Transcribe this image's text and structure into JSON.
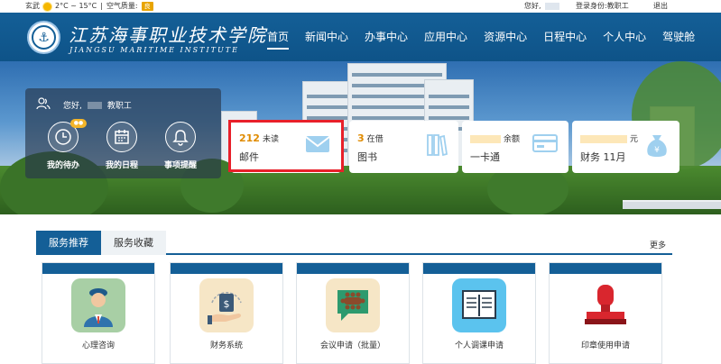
{
  "topbar": {
    "city": "玄武",
    "temperature": "2°C ~ 15°C",
    "separator": "|",
    "air_quality_label": "空气质量:",
    "air_quality_value": "良",
    "greeting": "您好,",
    "login_role": "登录身份:教职工",
    "logout": "退出"
  },
  "header": {
    "school_name_cn": "江苏海事职业技术学院",
    "school_name_en": "JIANGSU MARITIME INSTITUTE",
    "nav": [
      {
        "label": "首页",
        "active": true
      },
      {
        "label": "新闻中心"
      },
      {
        "label": "办事中心"
      },
      {
        "label": "应用中心"
      },
      {
        "label": "资源中心"
      },
      {
        "label": "日程中心"
      },
      {
        "label": "个人中心"
      },
      {
        "label": "驾驶舱"
      }
    ]
  },
  "user_panel": {
    "greeting": "您好,",
    "role": "教职工",
    "quick_actions": [
      {
        "label": "我的待办",
        "icon": "clock-icon"
      },
      {
        "label": "我的日程",
        "icon": "calendar-icon"
      },
      {
        "label": "事项提醒",
        "icon": "bell-icon"
      }
    ]
  },
  "cards": {
    "mail": {
      "count": "212",
      "count_label": "未读",
      "title": "邮件",
      "icon": "envelope-icon"
    },
    "library": {
      "count": "3",
      "count_label": "在借",
      "title": "图书",
      "icon": "books-icon"
    },
    "card": {
      "count_label": "余额",
      "title": "一卡通",
      "icon": "card-icon"
    },
    "finance": {
      "unit": "元",
      "title": "财务 11月",
      "icon": "money-bag-icon"
    }
  },
  "services": {
    "tabs": [
      {
        "label": "服务推荐",
        "active": true
      },
      {
        "label": "服务收藏"
      }
    ],
    "more": "更多",
    "items": [
      {
        "label": "心理咨询",
        "icon": "counselor-icon"
      },
      {
        "label": "财务系统",
        "icon": "finance-hand-icon"
      },
      {
        "label": "会议申请（批量）",
        "icon": "meeting-icon"
      },
      {
        "label": "个人调课申请",
        "icon": "book-board-icon"
      },
      {
        "label": "印章使用申请",
        "icon": "stamp-icon"
      }
    ]
  },
  "colors": {
    "brand": "#145f97",
    "accent": "#e08b00",
    "highlight": "#e8202a"
  }
}
